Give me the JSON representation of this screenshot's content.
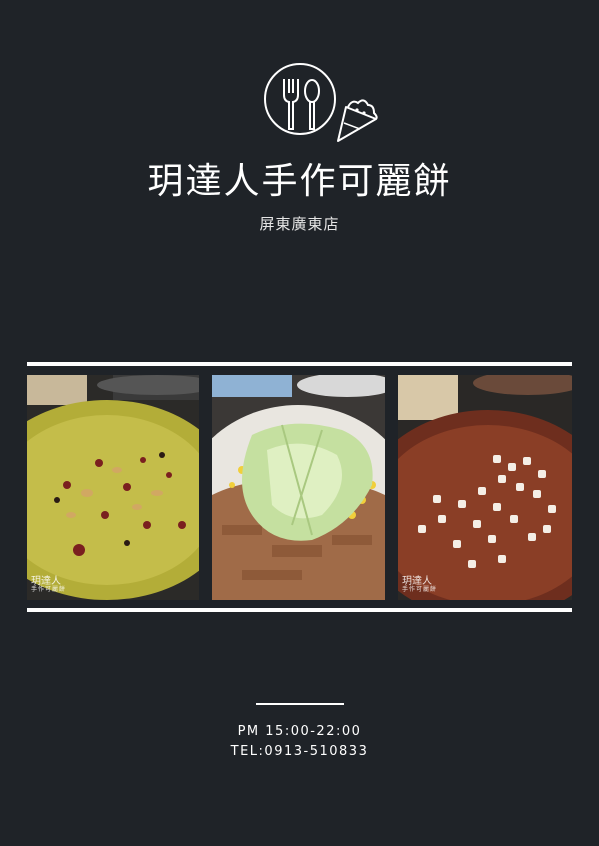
{
  "header": {
    "logo": {
      "icon": "fork-spoon-icon",
      "secondary_icon": "crepe-cone-icon"
    },
    "title": "玥達人手作可麗餅",
    "subtitle": "屏東廣東店"
  },
  "gallery": {
    "photos": [
      {
        "name": "matcha-crepe-with-nuts-and-cranberries",
        "watermark": "玥達人",
        "watermark_sub": "手作可麗餅"
      },
      {
        "name": "crepe-with-meat-floss-lettuce-and-corn",
        "watermark": "",
        "watermark_sub": ""
      },
      {
        "name": "chocolate-crepe-with-marshmallows",
        "watermark": "玥達人",
        "watermark_sub": "手作可麗餅"
      }
    ]
  },
  "footer": {
    "hours": "PM 15:00-22:00",
    "tel": "TEL:0913-510833"
  },
  "colors": {
    "background": "#1f2328",
    "text": "#ffffff",
    "rule": "#ffffff"
  }
}
